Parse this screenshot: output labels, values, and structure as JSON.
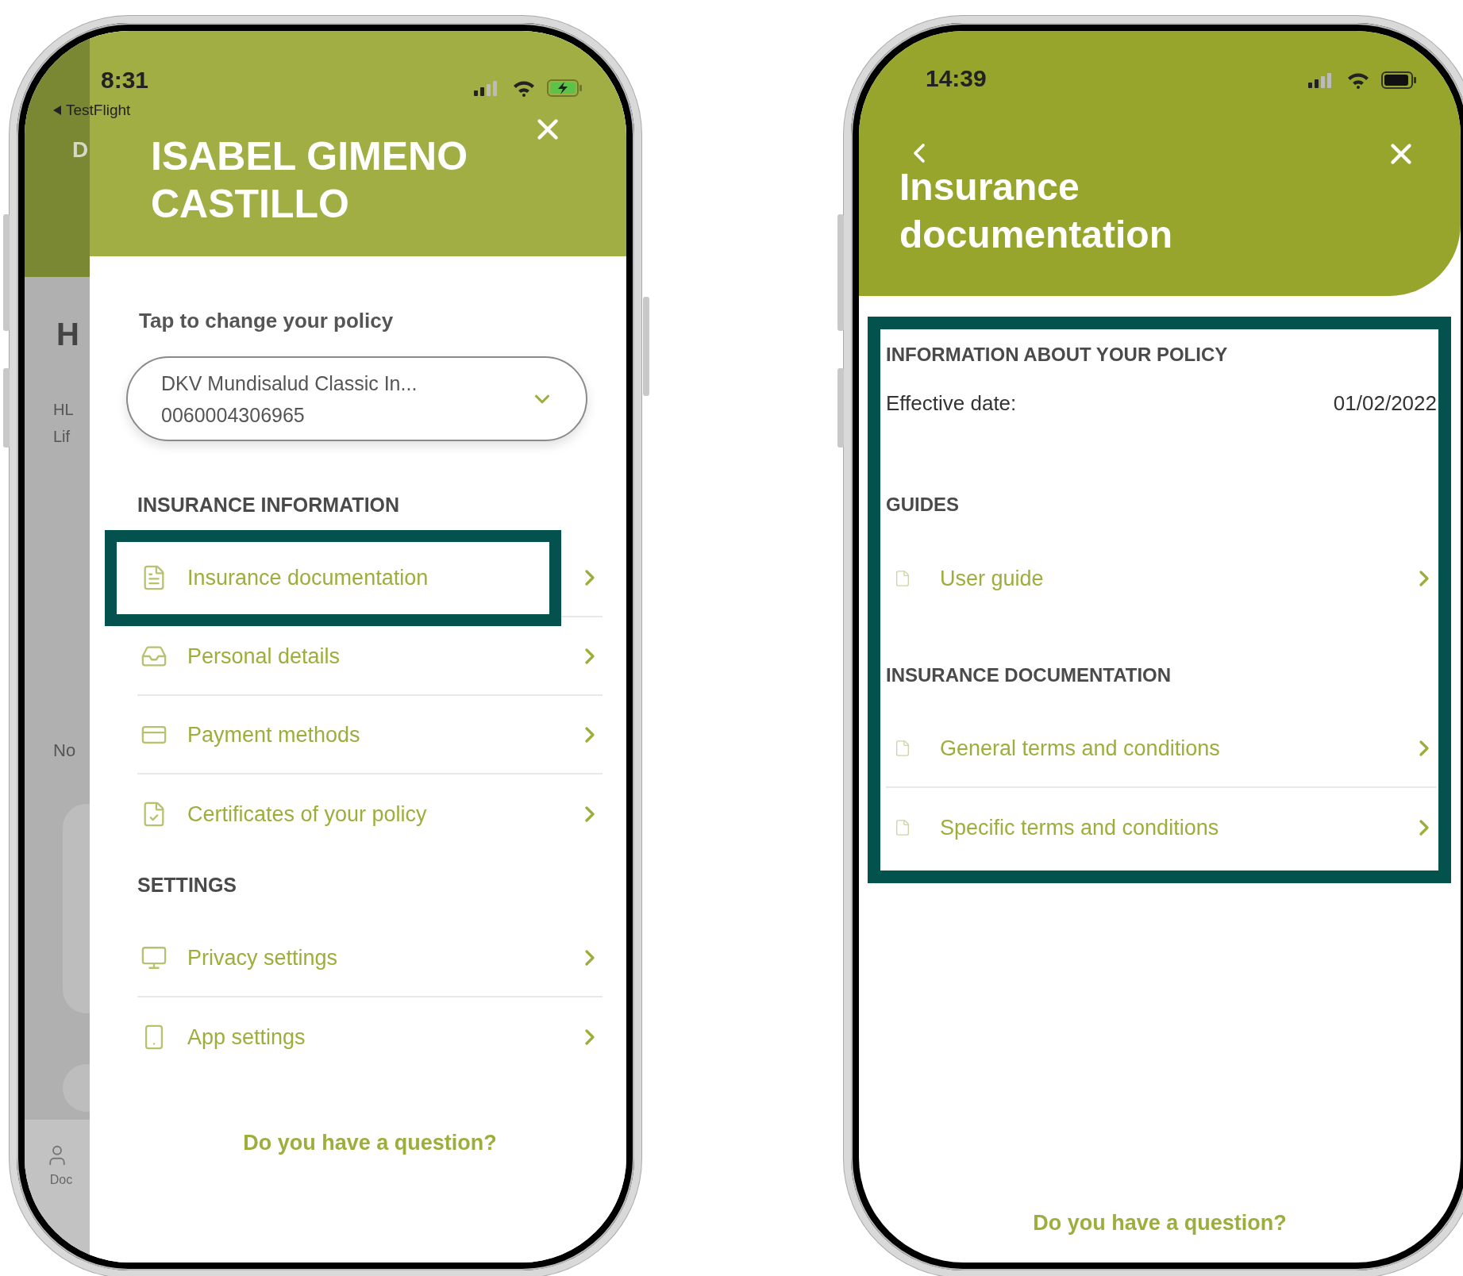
{
  "left_phone": {
    "status_bar": {
      "time": "8:31",
      "back_app": "TestFlight"
    },
    "background_app": {
      "logo_letter": "D",
      "heading": "H",
      "lines": [
        "HL",
        "Lif"
      ],
      "note": "No",
      "tab_label": "Doc"
    },
    "drawer": {
      "title": "ISABEL GIMENO CASTILLO",
      "policy_prompt": "Tap to change your policy",
      "policy_select": {
        "name": "DKV Mundisalud Classic In...",
        "number": "0060004306965"
      },
      "sections": [
        {
          "heading": "INSURANCE INFORMATION",
          "items": [
            {
              "label": "Insurance documentation",
              "highlighted": true
            },
            {
              "label": "Personal details",
              "highlighted": false
            },
            {
              "label": "Payment methods",
              "highlighted": false
            },
            {
              "label": "Certificates of your policy",
              "highlighted": false
            }
          ]
        },
        {
          "heading": "SETTINGS",
          "items": [
            {
              "label": "Privacy settings",
              "highlighted": false
            },
            {
              "label": "App settings",
              "highlighted": false
            }
          ]
        }
      ],
      "footer_link": "Do you have a question?"
    }
  },
  "right_phone": {
    "status_bar": {
      "time": "14:39"
    },
    "title": "Insurance documentation",
    "content": {
      "highlighted": true,
      "sections": [
        {
          "kind": "info",
          "heading": "INFORMATION ABOUT YOUR POLICY",
          "fields": [
            {
              "label": "Effective date:",
              "value": "01/02/2022"
            }
          ]
        },
        {
          "kind": "links",
          "heading": "GUIDES",
          "items": [
            {
              "label": "User guide"
            }
          ]
        },
        {
          "kind": "links",
          "heading": "INSURANCE DOCUMENTATION",
          "items": [
            {
              "label": "General terms and conditions"
            },
            {
              "label": "Specific terms and conditions"
            }
          ]
        }
      ]
    },
    "footer_link": "Do you have a question?"
  }
}
